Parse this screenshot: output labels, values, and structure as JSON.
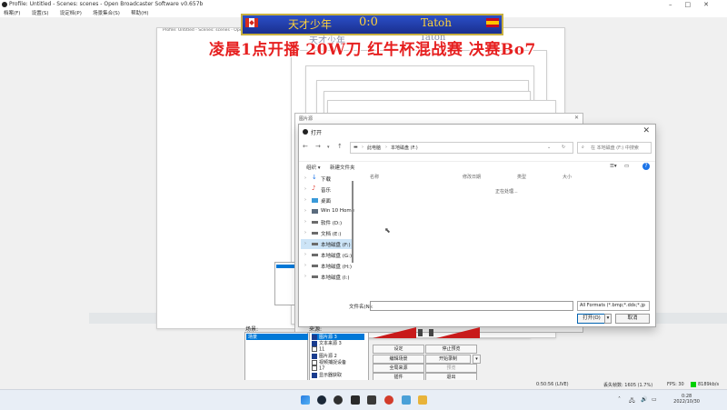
{
  "obs": {
    "title": "Profile: Untitled - Scenes: scenes - Open Broadcaster Software v0.657b",
    "menu": [
      "档案(F)",
      "设置(S)",
      "设定档(P)",
      "场景集合(S)",
      "帮助(H)"
    ],
    "nested_title": "Profile: Untitled - Scenes: scenes - Open Broadcaster Software v0.657b"
  },
  "banner": {
    "left_name": "天才少年",
    "score": "0:0",
    "right_name": "Tatoh",
    "ghost_left": "天才少年",
    "ghost_right": "Tatoh",
    "left_flag_color": "#d52b1e",
    "right_flag_color": "#c60b1e"
  },
  "headline": "凌晨1点开播 20W刀 红牛杯混战赛 决赛Bo7",
  "property_window": {
    "title": "图片源"
  },
  "dialog": {
    "title": "打开",
    "breadcrumb": [
      "此电脑",
      "本地磁盘 (F:)"
    ],
    "search_placeholder": "在 本地磁盘 (F:) 中搜索",
    "organize": "组织 ▾",
    "new_folder": "新建文件夹",
    "columns": {
      "name": "名称",
      "date": "修改日期",
      "type": "类型",
      "size": "大小"
    },
    "loading_text": "正在处理...",
    "nav_items": [
      {
        "label": "下载",
        "icon": "download-icon",
        "selected": false
      },
      {
        "label": "音乐",
        "icon": "music-icon",
        "selected": false
      },
      {
        "label": "桌面",
        "icon": "desktop-icon",
        "selected": false
      },
      {
        "label": "Win 10 Home",
        "icon": "drive-icon",
        "selected": false
      },
      {
        "label": "软件 (D:)",
        "icon": "drive-icon",
        "selected": false
      },
      {
        "label": "文档 (E:)",
        "icon": "drive-icon",
        "selected": false
      },
      {
        "label": "本地磁盘 (F:)",
        "icon": "drive-icon",
        "selected": true
      },
      {
        "label": "本地磁盘 (G:)",
        "icon": "drive-icon",
        "selected": false
      },
      {
        "label": "本地磁盘 (H:)",
        "icon": "drive-icon",
        "selected": false
      },
      {
        "label": "本地磁盘 (I:)",
        "icon": "drive-icon",
        "selected": false
      }
    ],
    "filename_label": "文件名(N):",
    "filename_value": "",
    "filter": "All Formats (*.bmp;*.dds;*.jp",
    "open_button": "打开(O)",
    "cancel_button": "取消"
  },
  "scenes": {
    "label": "场景:",
    "items": [
      "场景"
    ]
  },
  "sources": {
    "label": "来源:",
    "items": [
      {
        "label": "图片源 3",
        "checked": true,
        "selected": true
      },
      {
        "label": "文本来源 3",
        "checked": true,
        "selected": false
      },
      {
        "label": "11",
        "checked": false,
        "selected": false
      },
      {
        "label": "图片源 2",
        "checked": true,
        "selected": false
      },
      {
        "label": "视频捕捉设备",
        "checked": false,
        "selected": false
      },
      {
        "label": "17",
        "checked": false,
        "selected": false
      },
      {
        "label": "显示器获取",
        "checked": true,
        "selected": false
      }
    ]
  },
  "controls": {
    "settings": "设定",
    "stop_preview": "停止预览",
    "edit_scene": "编辑场景",
    "start_record": "开始录制",
    "global_sources": "全局来源",
    "plugins": "插件",
    "exit": "退出",
    "disabled": "预览"
  },
  "status": {
    "time": "0:50:56 (LIVE)",
    "dropped": "丢失帧数: 1605 (1.7%)",
    "fps": "FPS: 30",
    "bitrate": "8189kb/s"
  },
  "taskbar": {
    "time": "0:28",
    "date": "2022/10/30",
    "apps": [
      "windows-start-icon",
      "steam-icon",
      "obs-icon",
      "app-icon",
      "app-icon",
      "app-icon",
      "netease-music-icon",
      "chat-icon",
      "file-explorer-icon"
    ]
  }
}
